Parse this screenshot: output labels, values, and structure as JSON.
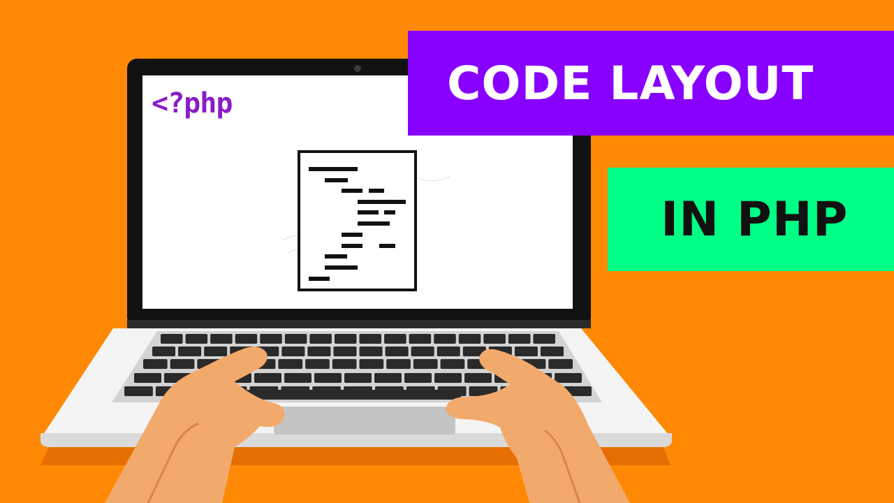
{
  "colors": {
    "background": "#FF8904",
    "title_banner": "#8800FF",
    "title_text": "#FFFFFF",
    "subtitle_banner": "#00FF85",
    "subtitle_text": "#111111",
    "code_accent": "#8A1CC7"
  },
  "screen": {
    "code_text": "<?php"
  },
  "title_banner": {
    "text": "CODE LAYOUT"
  },
  "subtitle_banner": {
    "text": "IN PHP"
  },
  "icons": {
    "document": "code-document-icon",
    "laptop": "laptop-icon",
    "hands": "typing-hands-icon"
  }
}
